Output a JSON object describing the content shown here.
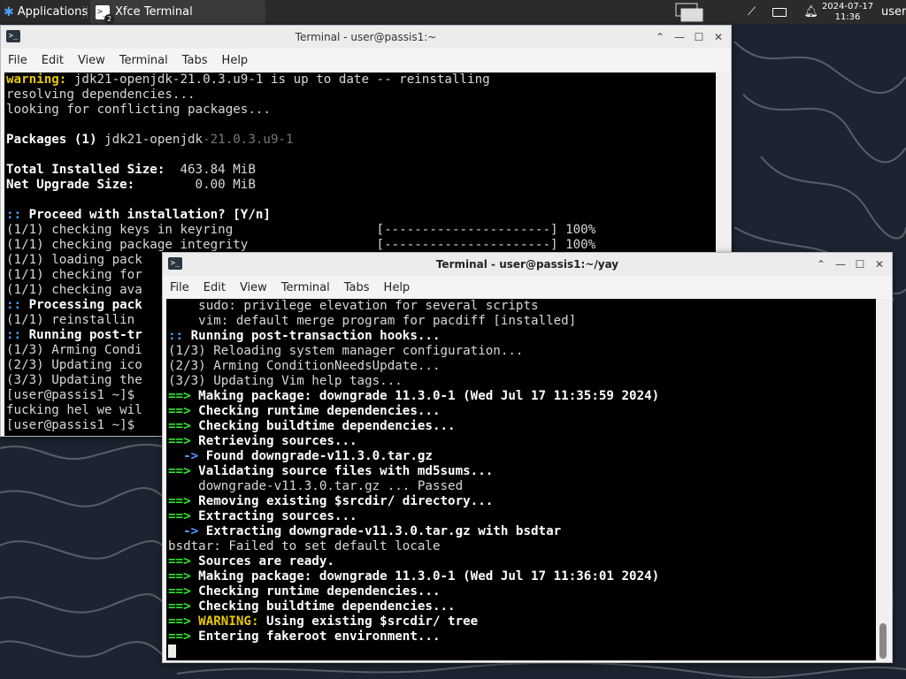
{
  "panel": {
    "applications": "Applications",
    "task": "Xfce Terminal",
    "task_badge": "2",
    "date": "2024-07-17",
    "time": "11:36",
    "user": "user"
  },
  "win1": {
    "title": "Terminal - user@passis1:~",
    "menu": [
      "File",
      "Edit",
      "View",
      "Terminal",
      "Tabs",
      "Help"
    ],
    "lines": [
      [
        {
          "t": "warning:",
          "c": "y"
        },
        {
          "t": " jdk21-openjdk-21.0.3.u9-1 is up to date -- reinstalling"
        }
      ],
      [
        {
          "t": "resolving dependencies..."
        }
      ],
      [
        {
          "t": "looking for conflicting packages..."
        }
      ],
      [
        {
          "t": ""
        }
      ],
      [
        {
          "t": "Packages (1)",
          "c": "b"
        },
        {
          "t": " jdk21-openjdk"
        },
        {
          "t": "-21.0.3.u9-1",
          "c": "dim"
        }
      ],
      [
        {
          "t": ""
        }
      ],
      [
        {
          "t": "Total Installed Size:",
          "c": "b"
        },
        {
          "t": "  463.84 MiB"
        }
      ],
      [
        {
          "t": "Net Upgrade Size:",
          "c": "b"
        },
        {
          "t": "        0.00 MiB"
        }
      ],
      [
        {
          "t": ""
        }
      ],
      [
        {
          "t": "::",
          "c": "bl"
        },
        {
          "t": " Proceed with installation? [Y/n]",
          "c": "b"
        }
      ],
      [
        {
          "t": "(1/1) checking keys in keyring                   [----------------------] 100%"
        }
      ],
      [
        {
          "t": "(1/1) checking package integrity                 [----------------------] 100%"
        }
      ],
      [
        {
          "t": "(1/1) loading pack"
        }
      ],
      [
        {
          "t": "(1/1) checking for"
        }
      ],
      [
        {
          "t": "(1/1) checking ava"
        }
      ],
      [
        {
          "t": "::",
          "c": "bl"
        },
        {
          "t": " Processing pack",
          "c": "b"
        }
      ],
      [
        {
          "t": "(1/1) reinstallin"
        }
      ],
      [
        {
          "t": "::",
          "c": "bl"
        },
        {
          "t": " Running post-tr",
          "c": "b"
        }
      ],
      [
        {
          "t": "(1/3) Arming Condi"
        }
      ],
      [
        {
          "t": "(2/3) Updating ico"
        }
      ],
      [
        {
          "t": "(3/3) Updating the"
        }
      ],
      [
        {
          "t": "[user@passis1 ~]$ "
        }
      ],
      [
        {
          "t": "fucking hel we wil"
        }
      ],
      [
        {
          "t": "[user@passis1 ~]$ "
        }
      ]
    ]
  },
  "win2": {
    "title": "Terminal - user@passis1:~/yay",
    "menu": [
      "File",
      "Edit",
      "View",
      "Terminal",
      "Tabs",
      "Help"
    ],
    "lines": [
      [
        {
          "t": "    sudo: privilege elevation for several scripts"
        }
      ],
      [
        {
          "t": "    vim: default merge program for pacdiff [installed]"
        }
      ],
      [
        {
          "t": "::",
          "c": "bl"
        },
        {
          "t": " Running post-transaction hooks...",
          "c": "b"
        }
      ],
      [
        {
          "t": "(1/3) Reloading system manager configuration..."
        }
      ],
      [
        {
          "t": "(2/3) Arming ConditionNeedsUpdate..."
        }
      ],
      [
        {
          "t": "(3/3) Updating Vim help tags..."
        }
      ],
      [
        {
          "t": "==>",
          "c": "g"
        },
        {
          "t": " Making package: downgrade 11.3.0-1 (Wed Jul 17 11:35:59 2024)",
          "c": "b"
        }
      ],
      [
        {
          "t": "==>",
          "c": "g"
        },
        {
          "t": " Checking runtime dependencies...",
          "c": "b"
        }
      ],
      [
        {
          "t": "==>",
          "c": "g"
        },
        {
          "t": " Checking buildtime dependencies...",
          "c": "b"
        }
      ],
      [
        {
          "t": "==>",
          "c": "g"
        },
        {
          "t": " Retrieving sources...",
          "c": "b"
        }
      ],
      [
        {
          "t": "  ->",
          "c": "bl"
        },
        {
          "t": " Found downgrade-v11.3.0.tar.gz",
          "c": "b"
        }
      ],
      [
        {
          "t": "==>",
          "c": "g"
        },
        {
          "t": " Validating source files with md5sums...",
          "c": "b"
        }
      ],
      [
        {
          "t": "    downgrade-v11.3.0.tar.gz ... Passed"
        }
      ],
      [
        {
          "t": "==>",
          "c": "g"
        },
        {
          "t": " Removing existing $srcdir/ directory...",
          "c": "b"
        }
      ],
      [
        {
          "t": "==>",
          "c": "g"
        },
        {
          "t": " Extracting sources...",
          "c": "b"
        }
      ],
      [
        {
          "t": "  ->",
          "c": "bl"
        },
        {
          "t": " Extracting downgrade-v11.3.0.tar.gz with bsdtar",
          "c": "b"
        }
      ],
      [
        {
          "t": "bsdtar: Failed to set default locale"
        }
      ],
      [
        {
          "t": "==>",
          "c": "g"
        },
        {
          "t": " Sources are ready.",
          "c": "b"
        }
      ],
      [
        {
          "t": "==>",
          "c": "g"
        },
        {
          "t": " Making package: downgrade 11.3.0-1 (Wed Jul 17 11:36:01 2024)",
          "c": "b"
        }
      ],
      [
        {
          "t": "==>",
          "c": "g"
        },
        {
          "t": " Checking runtime dependencies...",
          "c": "b"
        }
      ],
      [
        {
          "t": "==>",
          "c": "g"
        },
        {
          "t": " Checking buildtime dependencies...",
          "c": "b"
        }
      ],
      [
        {
          "t": "==>",
          "c": "g"
        },
        {
          "t": " WARNING:",
          "c": "y"
        },
        {
          "t": " Using existing $srcdir/ tree",
          "c": "b"
        }
      ],
      [
        {
          "t": "==>",
          "c": "g"
        },
        {
          "t": " Entering fakeroot environment...",
          "c": "b"
        }
      ]
    ]
  }
}
